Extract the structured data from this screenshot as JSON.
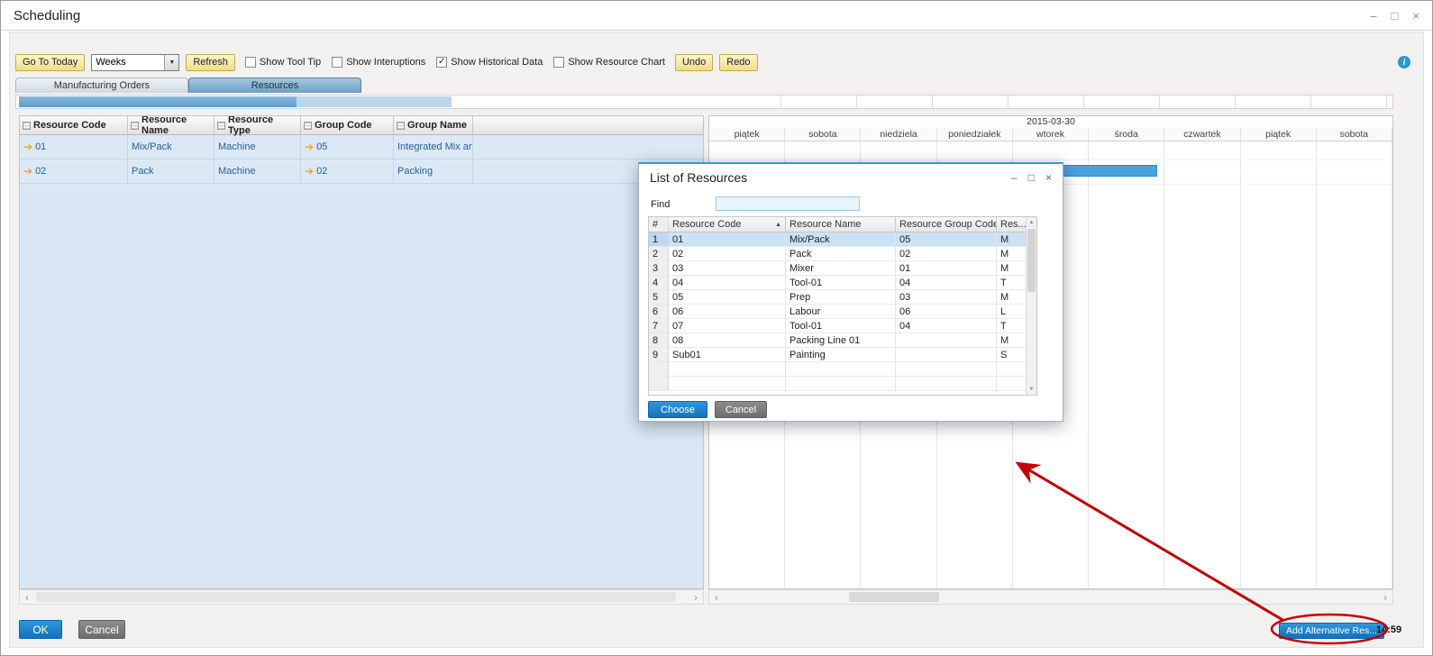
{
  "window": {
    "title": "Scheduling"
  },
  "icons": {
    "minimize": "–",
    "maximize": "□",
    "close": "×",
    "info": "i",
    "dropdown_arrow": "▼",
    "link_arrow": "➔",
    "sort_asc": "▲",
    "chevron_left": "‹",
    "chevron_right": "›",
    "arrow_up": "▲",
    "arrow_down": "▼"
  },
  "colors": {
    "gantt_bar_blue": "#4ba1dc",
    "button_blue": "#1b86d8",
    "annotation_red": "#cc0000",
    "row_blue": "#dce9f5"
  },
  "toolbar": {
    "go_to_today_label": "Go To Today",
    "period_value": "Weeks",
    "refresh_label": "Refresh",
    "checkboxes": [
      {
        "label": "Show Tool Tip",
        "checked": false,
        "mark": ""
      },
      {
        "label": "Show Interuptions",
        "checked": false,
        "mark": ""
      },
      {
        "label": "Show Historical Data",
        "checked": true,
        "mark": "✓"
      },
      {
        "label": "Show Resource Chart",
        "checked": false,
        "mark": ""
      }
    ],
    "undo_label": "Undo",
    "redo_label": "Redo"
  },
  "tabs": {
    "manufacturing_orders": "Manufacturing Orders",
    "resources": "Resources",
    "active": "Resources"
  },
  "resource_table": {
    "columns": [
      "Resource Code",
      "Resource Name",
      "Resource Type",
      "Group Code",
      "Group Name"
    ],
    "rows": [
      {
        "code": "01",
        "name": "Mix/Pack",
        "type": "Machine",
        "group_code": "05",
        "group_name": "Integrated Mix and Pa"
      },
      {
        "code": "02",
        "name": "Pack",
        "type": "Machine",
        "group_code": "02",
        "group_name": "Packing"
      }
    ]
  },
  "gantt": {
    "week_label": "2015-03-30",
    "days": [
      "piątek",
      "sobota",
      "niedziela",
      "poniedziałek",
      "wtorek",
      "środa",
      "czwartek",
      "piątek",
      "sobota"
    ],
    "bar": {
      "row_index": 1,
      "start_day": 0,
      "end_day": 5.9
    }
  },
  "dialog": {
    "title": "List of Resources",
    "find_label": "Find",
    "find_value": "",
    "columns": [
      "#",
      "Resource Code",
      "Resource Name",
      "Resource Group Code",
      "Res..."
    ],
    "selected_index": 0,
    "rows": [
      {
        "num": "1",
        "code": "01",
        "name": "Mix/Pack",
        "group": "05",
        "type": "M"
      },
      {
        "num": "2",
        "code": "02",
        "name": "Pack",
        "group": "02",
        "type": "M"
      },
      {
        "num": "3",
        "code": "03",
        "name": "Mixer",
        "group": "01",
        "type": "M"
      },
      {
        "num": "4",
        "code": "04",
        "name": "Tool-01",
        "group": "04",
        "type": "T"
      },
      {
        "num": "5",
        "code": "05",
        "name": "Prep",
        "group": "03",
        "type": "M"
      },
      {
        "num": "6",
        "code": "06",
        "name": "Labour",
        "group": "06",
        "type": "L"
      },
      {
        "num": "7",
        "code": "07",
        "name": "Tool-01",
        "group": "04",
        "type": "T"
      },
      {
        "num": "8",
        "code": "08",
        "name": "Packing Line 01",
        "group": "",
        "type": "M"
      },
      {
        "num": "9",
        "code": "Sub01",
        "name": "Painting",
        "group": "",
        "type": "S"
      }
    ],
    "choose_label": "Choose",
    "cancel_label": "Cancel"
  },
  "footer": {
    "ok_label": "OK",
    "cancel_label": "Cancel",
    "add_alternative_label": "Add Alternative Res...",
    "time": "14:59"
  }
}
